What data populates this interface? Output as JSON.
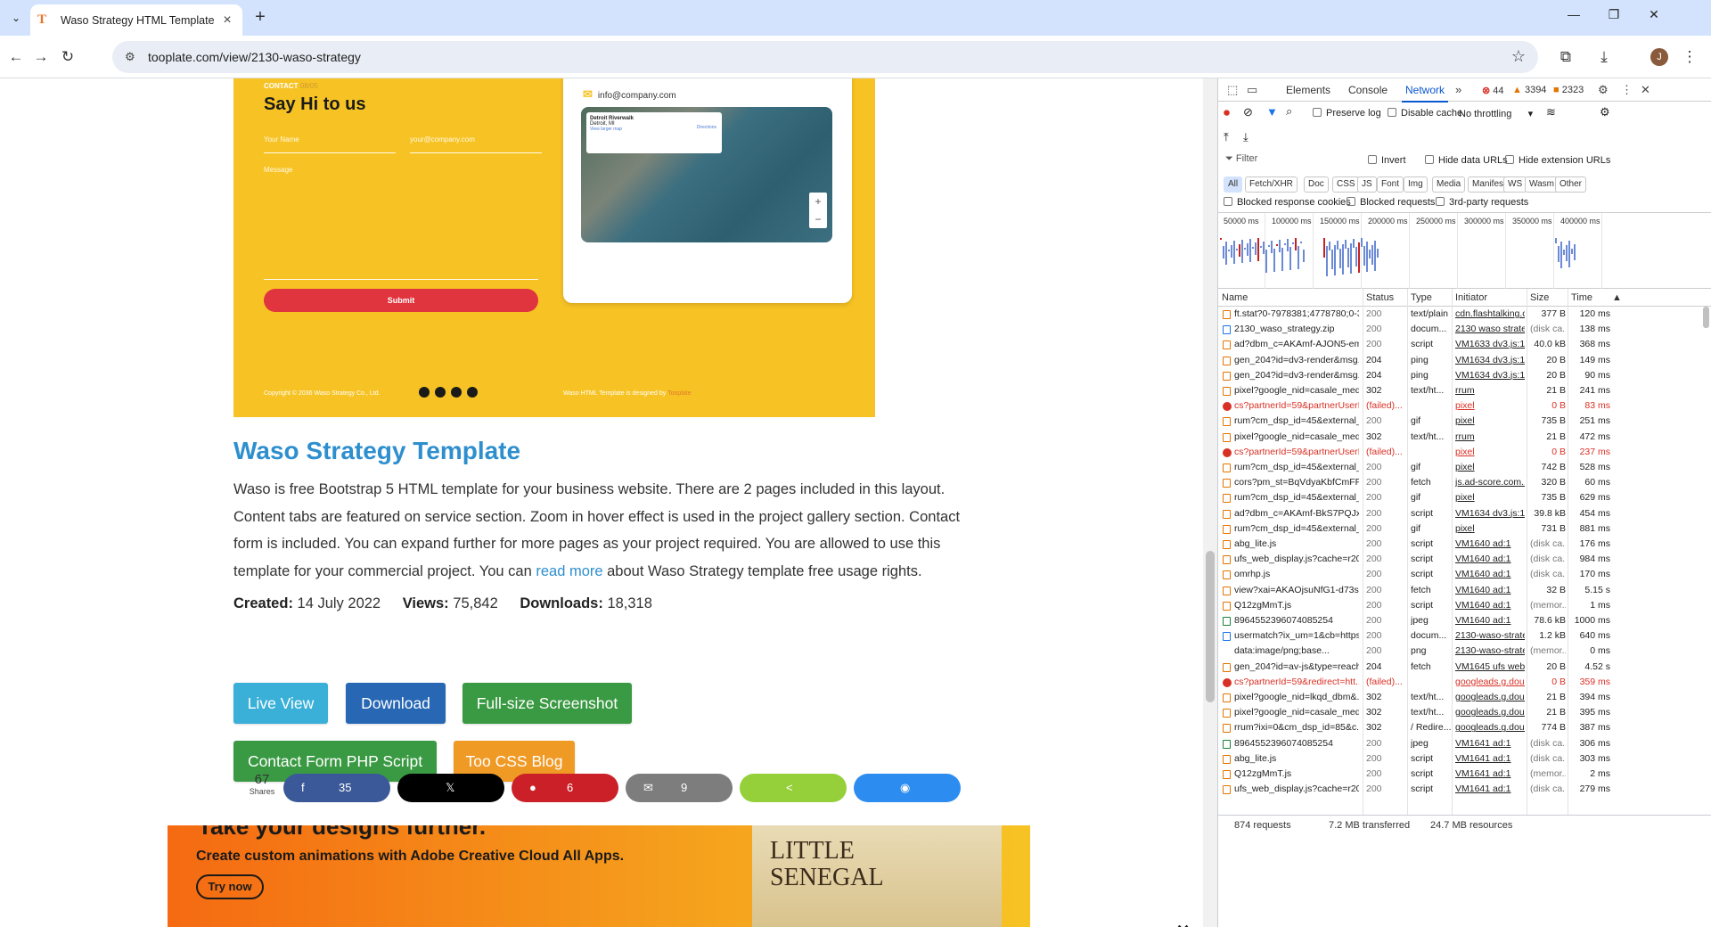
{
  "browser": {
    "tab_title": "Waso Strategy HTML Template",
    "url": "tooplate.com/view/2130-waso-strategy"
  },
  "preview": {
    "contact_kicker": "CONTACT",
    "contact_count": "08/05",
    "say_hi": "Say Hi to us",
    "name_placeholder": "Your Name",
    "email_placeholder": "your@company.com",
    "message_placeholder": "Message",
    "submit": "Submit",
    "email": "info@company.com",
    "map_place": "Detroit Riverwalk",
    "map_city": "Detroit, MI",
    "map_link": "View larger map",
    "map_directions": "Directions",
    "copyright": "Copyright © 2036 Waso Strategy Co., Ltd.",
    "designed_by": "Waso HTML Template is designed by",
    "designer": "Tooplate"
  },
  "page": {
    "title": "Waso Strategy Template",
    "desc_1": "Waso is free Bootstrap 5 HTML template for your business website. There are 2 pages included in this layout. Content tabs are featured on service section. Zoom in hover effect is used in the project gallery section. Contact form is included. You can expand further for more pages as your project required. You are allowed to use this template for your commercial project. You can ",
    "desc_link": "read more",
    "desc_2": " about Waso Strategy template free usage rights.",
    "created_label": "Created:",
    "created": "14 July 2022",
    "views_label": "Views:",
    "views": "75,842",
    "downloads_label": "Downloads:",
    "downloads": "18,318",
    "buttons": {
      "live": "Live View",
      "download": "Download",
      "screenshot": "Full-size Screenshot",
      "php": "Contact Form PHP Script",
      "blog": "Too CSS Blog"
    },
    "shares_count": "67",
    "shares_label": "Shares",
    "share_counts": {
      "facebook": "35",
      "pinterest": "6",
      "email": "9"
    }
  },
  "ad": {
    "headline": "Take your designs further.",
    "sub": "Create custom animations with Adobe Creative Cloud All Apps.",
    "cta": "Try now",
    "image_text_1": "LITTLE",
    "image_text_2": "SENEGAL"
  },
  "devtools": {
    "tabs": [
      "Elements",
      "Console",
      "Network"
    ],
    "errors": "44",
    "warnings": "3394",
    "issues": "2323",
    "preserve_log": "Preserve log",
    "disable_cache": "Disable cache",
    "throttling": "No throttling",
    "filter_placeholder": "Filter",
    "invert": "Invert",
    "hide_data_urls": "Hide data URLs",
    "hide_ext_urls": "Hide extension URLs",
    "types": [
      "All",
      "Fetch/XHR",
      "Doc",
      "CSS",
      "JS",
      "Font",
      "Img",
      "Media",
      "Manifest",
      "WS",
      "Wasm",
      "Other"
    ],
    "blocked_cookies": "Blocked response cookies",
    "blocked_requests": "Blocked requests",
    "third_party": "3rd-party requests",
    "ticks": [
      "50000 ms",
      "100000 ms",
      "150000 ms",
      "200000 ms",
      "250000 ms",
      "300000 ms",
      "350000 ms",
      "400000 ms"
    ],
    "columns": [
      "Name",
      "Status",
      "Type",
      "Initiator",
      "Size",
      "Time"
    ],
    "rows": [
      {
        "kind": "xhr",
        "name": "ft.stat?0-7978381;4778780;0-3...",
        "status": "200",
        "type": "text/plain",
        "init": "cdn.flashtalking.cc",
        "size": "377 B",
        "time": "120 ms"
      },
      {
        "kind": "doc",
        "name": "2130_waso_strategy.zip",
        "status": "200",
        "type": "docum...",
        "init": "2130 waso strate(",
        "size": "(disk ca...",
        "time": "138 ms"
      },
      {
        "kind": "xhr",
        "name": "ad?dbm_c=AKAmf-AJON5-em...",
        "status": "200",
        "type": "script",
        "init": "VM1633 dv3.js:16",
        "size": "40.0 kB",
        "time": "368 ms"
      },
      {
        "kind": "xhr",
        "name": "gen_204?id=dv3-render&msg...",
        "status": "204",
        "type": "ping",
        "init": "VM1634 dv3.js:10",
        "size": "20 B",
        "time": "149 ms"
      },
      {
        "kind": "xhr",
        "name": "gen_204?id=dv3-render&msg...",
        "status": "204",
        "type": "ping",
        "init": "VM1634 dv3.js:10",
        "size": "20 B",
        "time": "90 ms"
      },
      {
        "kind": "xhr",
        "name": "pixel?google_nid=casale_medi...",
        "status": "302",
        "type": "text/ht...",
        "init": "rrum",
        "size": "21 B",
        "time": "241 ms"
      },
      {
        "kind": "err",
        "name": "cs?partnerId=59&partnerUserI...",
        "status": "(failed)...",
        "type": "",
        "init": "pixel",
        "size": "0 B",
        "time": "83 ms"
      },
      {
        "kind": "xhr",
        "name": "rum?cm_dsp_id=45&external_...",
        "status": "200",
        "type": "gif",
        "init": "pixel",
        "size": "735 B",
        "time": "251 ms"
      },
      {
        "kind": "xhr",
        "name": "pixel?google_nid=casale_medi...",
        "status": "302",
        "type": "text/ht...",
        "init": "rrum",
        "size": "21 B",
        "time": "472 ms"
      },
      {
        "kind": "err",
        "name": "cs?partnerId=59&partnerUserI...",
        "status": "(failed)...",
        "type": "",
        "init": "pixel",
        "size": "0 B",
        "time": "237 ms"
      },
      {
        "kind": "xhr",
        "name": "rum?cm_dsp_id=45&external_...",
        "status": "200",
        "type": "gif",
        "init": "pixel",
        "size": "742 B",
        "time": "528 ms"
      },
      {
        "kind": "xhr",
        "name": "cors?pm_st=BqVdyaKbfCmFPT...",
        "status": "200",
        "type": "fetch",
        "init": "js.ad-score.com...",
        "size": "320 B",
        "time": "60 ms"
      },
      {
        "kind": "xhr",
        "name": "rum?cm_dsp_id=45&external_...",
        "status": "200",
        "type": "gif",
        "init": "pixel",
        "size": "735 B",
        "time": "629 ms"
      },
      {
        "kind": "xhr",
        "name": "ad?dbm_c=AKAmf-BkS7PQJxq...",
        "status": "200",
        "type": "script",
        "init": "VM1634 dv3.js:16",
        "size": "39.8 kB",
        "time": "454 ms"
      },
      {
        "kind": "xhr",
        "name": "rum?cm_dsp_id=45&external_...",
        "status": "200",
        "type": "gif",
        "init": "pixel",
        "size": "731 B",
        "time": "881 ms"
      },
      {
        "kind": "xhr",
        "name": "abg_lite.js",
        "status": "200",
        "type": "script",
        "init": "VM1640 ad:1",
        "size": "(disk ca...",
        "time": "176 ms"
      },
      {
        "kind": "xhr",
        "name": "ufs_web_display.js?cache=r201...",
        "status": "200",
        "type": "script",
        "init": "VM1640 ad:1",
        "size": "(disk ca...",
        "time": "984 ms"
      },
      {
        "kind": "xhr",
        "name": "omrhp.js",
        "status": "200",
        "type": "script",
        "init": "VM1640 ad:1",
        "size": "(disk ca...",
        "time": "170 ms"
      },
      {
        "kind": "xhr",
        "name": "view?xai=AKAOjsuNfG1-d73sn...",
        "status": "200",
        "type": "fetch",
        "init": "VM1640 ad:1",
        "size": "32 B",
        "time": "5.15 s"
      },
      {
        "kind": "xhr",
        "name": "Q12zgMmT.js",
        "status": "200",
        "type": "script",
        "init": "VM1640 ad:1",
        "size": "(memor...",
        "time": "1 ms"
      },
      {
        "kind": "img",
        "name": "8964552396074085254",
        "status": "200",
        "type": "jpeg",
        "init": "VM1640 ad:1",
        "size": "78.6 kB",
        "time": "1000 ms"
      },
      {
        "kind": "doc",
        "name": "usermatch?ix_um=1&cb=https...",
        "status": "200",
        "type": "docum...",
        "init": "2130-waso-strate(",
        "size": "1.2 kB",
        "time": "640 ms"
      },
      {
        "kind": "none",
        "name": "data:image/png;base...",
        "status": "200",
        "type": "png",
        "init": "2130-waso-strate(",
        "size": "(memor...",
        "time": "0 ms"
      },
      {
        "kind": "xhr",
        "name": "gen_204?id=av-js&type=reach...",
        "status": "204",
        "type": "fetch",
        "init": "VM1645 ufs web",
        "size": "20 B",
        "time": "4.52 s"
      },
      {
        "kind": "err",
        "name": "cs?partnerId=59&redirect=htt...",
        "status": "(failed)...",
        "type": "",
        "init": "googleads.g.doub",
        "size": "0 B",
        "time": "359 ms"
      },
      {
        "kind": "xhr",
        "name": "pixel?google_nid=lkqd_dbm&...",
        "status": "302",
        "type": "text/ht...",
        "init": "googleads.g.doub",
        "size": "21 B",
        "time": "394 ms"
      },
      {
        "kind": "xhr",
        "name": "pixel?google_nid=casale_medi...",
        "status": "302",
        "type": "text/ht...",
        "init": "googleads.g.doub",
        "size": "21 B",
        "time": "395 ms"
      },
      {
        "kind": "xhr",
        "name": "rrum?ixi=0&cm_dsp_id=85&c...",
        "status": "302",
        "type": "/ Redire...",
        "init": "googleads.g.doub",
        "size": "774 B",
        "time": "387 ms"
      },
      {
        "kind": "img",
        "name": "8964552396074085254",
        "status": "200",
        "type": "jpeg",
        "init": "VM1641 ad:1",
        "size": "(disk ca...",
        "time": "306 ms"
      },
      {
        "kind": "xhr",
        "name": "abg_lite.js",
        "status": "200",
        "type": "script",
        "init": "VM1641 ad:1",
        "size": "(disk ca...",
        "time": "303 ms"
      },
      {
        "kind": "xhr",
        "name": "Q12zgMmT.js",
        "status": "200",
        "type": "script",
        "init": "VM1641 ad:1",
        "size": "(memor...",
        "time": "2 ms"
      },
      {
        "kind": "xhr",
        "name": "ufs_web_display.js?cache=r201...",
        "status": "200",
        "type": "script",
        "init": "VM1641 ad:1",
        "size": "(disk ca...",
        "time": "279 ms"
      }
    ],
    "status_requests": "874 requests",
    "status_transferred": "7.2 MB transferred",
    "status_resources": "24.7 MB resources"
  }
}
